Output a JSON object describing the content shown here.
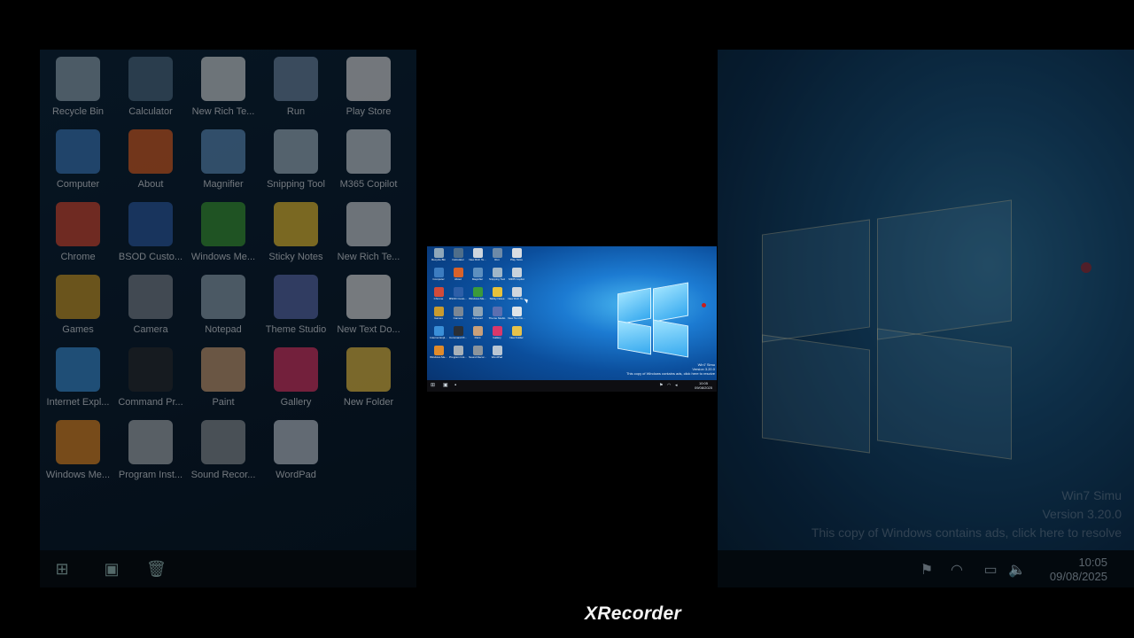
{
  "desktop": {
    "icons": [
      {
        "label": "Recycle Bin",
        "icon": "recycle-bin-icon",
        "color": "#8fa7b9"
      },
      {
        "label": "Calculator",
        "icon": "calculator-icon",
        "color": "#4f6e8a"
      },
      {
        "label": "New Rich Te...",
        "icon": "document-icon",
        "color": "#cfd6dd"
      },
      {
        "label": "Run",
        "icon": "run-icon",
        "color": "#6d8aa8"
      },
      {
        "label": "Play Store",
        "icon": "play-store-icon",
        "color": "#d9dde2"
      },
      {
        "label": "Computer",
        "icon": "computer-icon",
        "color": "#3c7cc0"
      },
      {
        "label": "About",
        "icon": "windows-flag-icon",
        "color": "#d8622a"
      },
      {
        "label": "Magnifier",
        "icon": "magnifier-icon",
        "color": "#5d8fbf"
      },
      {
        "label": "Snipping Tool",
        "icon": "scissors-icon",
        "color": "#9fb6c8"
      },
      {
        "label": "M365 Copilot",
        "icon": "copilot-icon",
        "color": "#c7d2dc"
      },
      {
        "label": "Chrome",
        "icon": "chrome-icon",
        "color": "#d24b3a"
      },
      {
        "label": "BSOD Custo...",
        "icon": "monitor-icon",
        "color": "#2d5fa8"
      },
      {
        "label": "Windows Me...",
        "icon": "media-center-icon",
        "color": "#3b9a3b"
      },
      {
        "label": "Sticky Notes",
        "icon": "sticky-note-icon",
        "color": "#e7c23a"
      },
      {
        "label": "New Rich Te...",
        "icon": "document-icon",
        "color": "#cfd6dd"
      },
      {
        "label": "Games",
        "icon": "games-icon",
        "color": "#c99b2e"
      },
      {
        "label": "Camera",
        "icon": "camera-icon",
        "color": "#7b8794"
      },
      {
        "label": "Notepad",
        "icon": "notepad-icon",
        "color": "#8ea4b6"
      },
      {
        "label": "Theme Studio",
        "icon": "theme-studio-icon",
        "color": "#5b6fb0"
      },
      {
        "label": "New Text Do...",
        "icon": "text-document-icon",
        "color": "#dfe4e8"
      },
      {
        "label": "Internet Expl...",
        "icon": "internet-explorer-icon",
        "color": "#3a8fd8"
      },
      {
        "label": "Command Pr...",
        "icon": "command-prompt-icon",
        "color": "#2a2f36"
      },
      {
        "label": "Paint",
        "icon": "paint-palette-icon",
        "color": "#c9a07a"
      },
      {
        "label": "Gallery",
        "icon": "gallery-icon",
        "color": "#d9386a"
      },
      {
        "label": "New Folder",
        "icon": "folder-icon",
        "color": "#e6c24a"
      },
      {
        "label": "Windows Me...",
        "icon": "media-player-icon",
        "color": "#e08a2a"
      },
      {
        "label": "Program Inst...",
        "icon": "installer-icon",
        "color": "#a7b0b8"
      },
      {
        "label": "Sound Recor...",
        "icon": "microphone-icon",
        "color": "#8b949c"
      },
      {
        "label": "WordPad",
        "icon": "wordpad-icon",
        "color": "#b9c6d3"
      }
    ]
  },
  "taskbar": {
    "left_icons": [
      "start-icon",
      "explorer-icon",
      "recycle-bin-icon"
    ],
    "tray_icons": [
      "flag-icon",
      "wifi-icon",
      "battery-icon",
      "volume-icon"
    ],
    "time": "10:05",
    "date": "09/08/2025"
  },
  "watermark_info": {
    "line1": "Win7 Simu",
    "line2": "Version 3.20.0",
    "line3": "This copy of Windows contains ads, click here to resolve"
  },
  "recorder": {
    "brand": "XRecorder"
  },
  "colors": {
    "desktop_blue": "#1c7bd2",
    "taskbar": "#0e0e12",
    "record_dot": "#c81e1e"
  }
}
